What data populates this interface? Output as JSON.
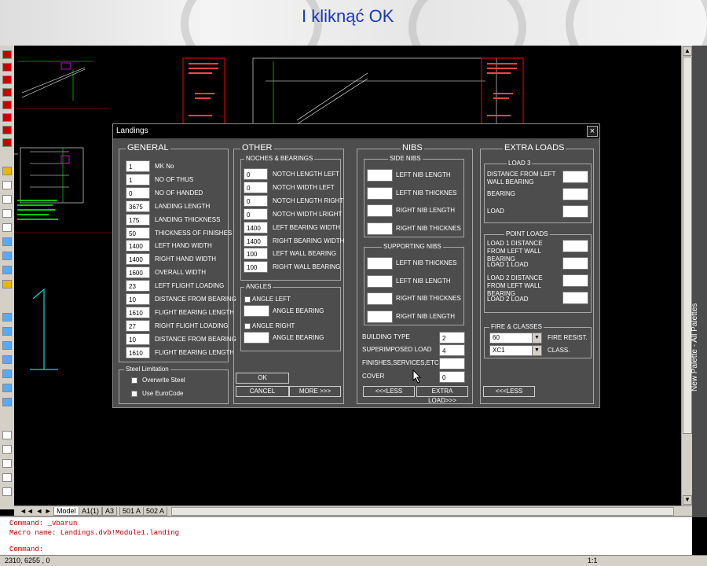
{
  "banner": {
    "title": "I kliknąć OK"
  },
  "palette": {
    "label": "New Palette - All Palettes"
  },
  "tabs": [
    "Model",
    "A1(1)",
    "A3",
    "501 A",
    "502 A"
  ],
  "command_lines": [
    "Command: _vbarun",
    "Macro name: Landings.dvb!Module1.landing",
    "Command:"
  ],
  "status": {
    "coords": "2310, 6255 , 0",
    "scale": "1:1"
  },
  "dialog": {
    "title": "Landings",
    "close": "×",
    "general": {
      "title": "GENERAL",
      "rows": [
        {
          "value": "1",
          "label": "MK No"
        },
        {
          "value": "1",
          "label": "NO OF THUS"
        },
        {
          "value": "0",
          "label": "NO OF HANDED"
        },
        {
          "value": "3675",
          "label": "LANDING LENGTH"
        },
        {
          "value": "175",
          "label": "LANDING THICKNESS"
        },
        {
          "value": "50",
          "label": "THICKNESS OF FINISHES"
        },
        {
          "value": "1400",
          "label": "LEFT HAND WIDTH"
        },
        {
          "value": "1400",
          "label": "RIGHT HAND WIDTH"
        },
        {
          "value": "1600",
          "label": "OVERALL WIDTH"
        },
        {
          "value": "23",
          "label": "LEFT FLIGHT LOADING"
        },
        {
          "value": "10",
          "label": "DISTANCE  FROM BEARING"
        },
        {
          "value": "1610",
          "label": "FLIGHT BEARING LENGTH"
        },
        {
          "value": "27",
          "label": "RIGHT FLIGHT LOADING"
        },
        {
          "value": "10",
          "label": "DISTANCE  FROM BEARING"
        },
        {
          "value": "1610",
          "label": "FLIGHT BEARING LENGTH"
        }
      ]
    },
    "steel": {
      "title": "Steel Limitation",
      "overwrite": "Overwrite Steel",
      "eurocode": "Use EuroCode"
    },
    "other": {
      "title": "OTHER",
      "noches_title": "NOCHES & BEARINGS",
      "rows": [
        {
          "value": "0",
          "label": "NOTCH LENGTH LEFT"
        },
        {
          "value": "0",
          "label": "NOTCH WIDTH LEFT"
        },
        {
          "value": "0",
          "label": "NOTCH LENGTH RIGHT"
        },
        {
          "value": "0",
          "label": "NOTCH WIDTH LRIGHT"
        },
        {
          "value": "1400",
          "label": "LEFT BEARING WIDTH"
        },
        {
          "value": "1400",
          "label": "RIGHT BEARING WIDTH"
        },
        {
          "value": "100",
          "label": "LEFT WALL BEARING"
        },
        {
          "value": "100",
          "label": "RIGHT WALL BEARING"
        }
      ],
      "angles_title": "ANGLES",
      "angle_left": "ANGLE LEFT",
      "angle_bearing": "ANGLE BEARING",
      "angle_right": "ANGLE RIGHT",
      "ok": "OK",
      "cancel": "CANCEL",
      "more": "MORE >>>"
    },
    "nibs": {
      "title": "NIBS",
      "side_title": "SIDE NIBS",
      "side": [
        "LEFT NIB LENGTH",
        "LEFT NIB THICKNES",
        "RIGHT NIB LENGTH",
        "RIGHT NIB THICKNES"
      ],
      "supporting_title": "SUPPORTING NIBS",
      "supporting": [
        "LEFT NIB THICKNES",
        "LEFT NIB LENGTH",
        "RIGHT NIB THICKNES",
        "RIGHT NIB LENGTH"
      ],
      "building_type": {
        "label": "BUILDING TYPE",
        "value": "2"
      },
      "superimposed": {
        "label": "SUPERIMPOSED LOAD",
        "value": "4"
      },
      "finishes": {
        "label": "FINISHES,SERVICES,ETC",
        "value": ""
      },
      "cover": {
        "label": "COVER",
        "value": "0"
      },
      "less": "<<<LESS",
      "extra": "EXTRA LOAD>>>"
    },
    "extra": {
      "title": "EXTRA LOADS",
      "load3_title": "LOAD 3",
      "load3": [
        "DISTANCE FROM LEFT WALL BEARING",
        "BEARING",
        "LOAD"
      ],
      "point_title": "POINT LOADS",
      "point": [
        "LOAD 1 DISTANCE FROM LEFT WALL BEARING",
        "LOAD 1 LOAD",
        "LOAD 2 DISTANCE FROM LEFT WALL BEARING",
        "LOAD 2 LOAD"
      ],
      "fire_title": "FIRE & CLASSES",
      "fire_value": "60",
      "fire_label": "FIRE RESIST.",
      "class_value": "XC1",
      "class_label": "CLASS.",
      "less": "<<<LESS"
    }
  }
}
